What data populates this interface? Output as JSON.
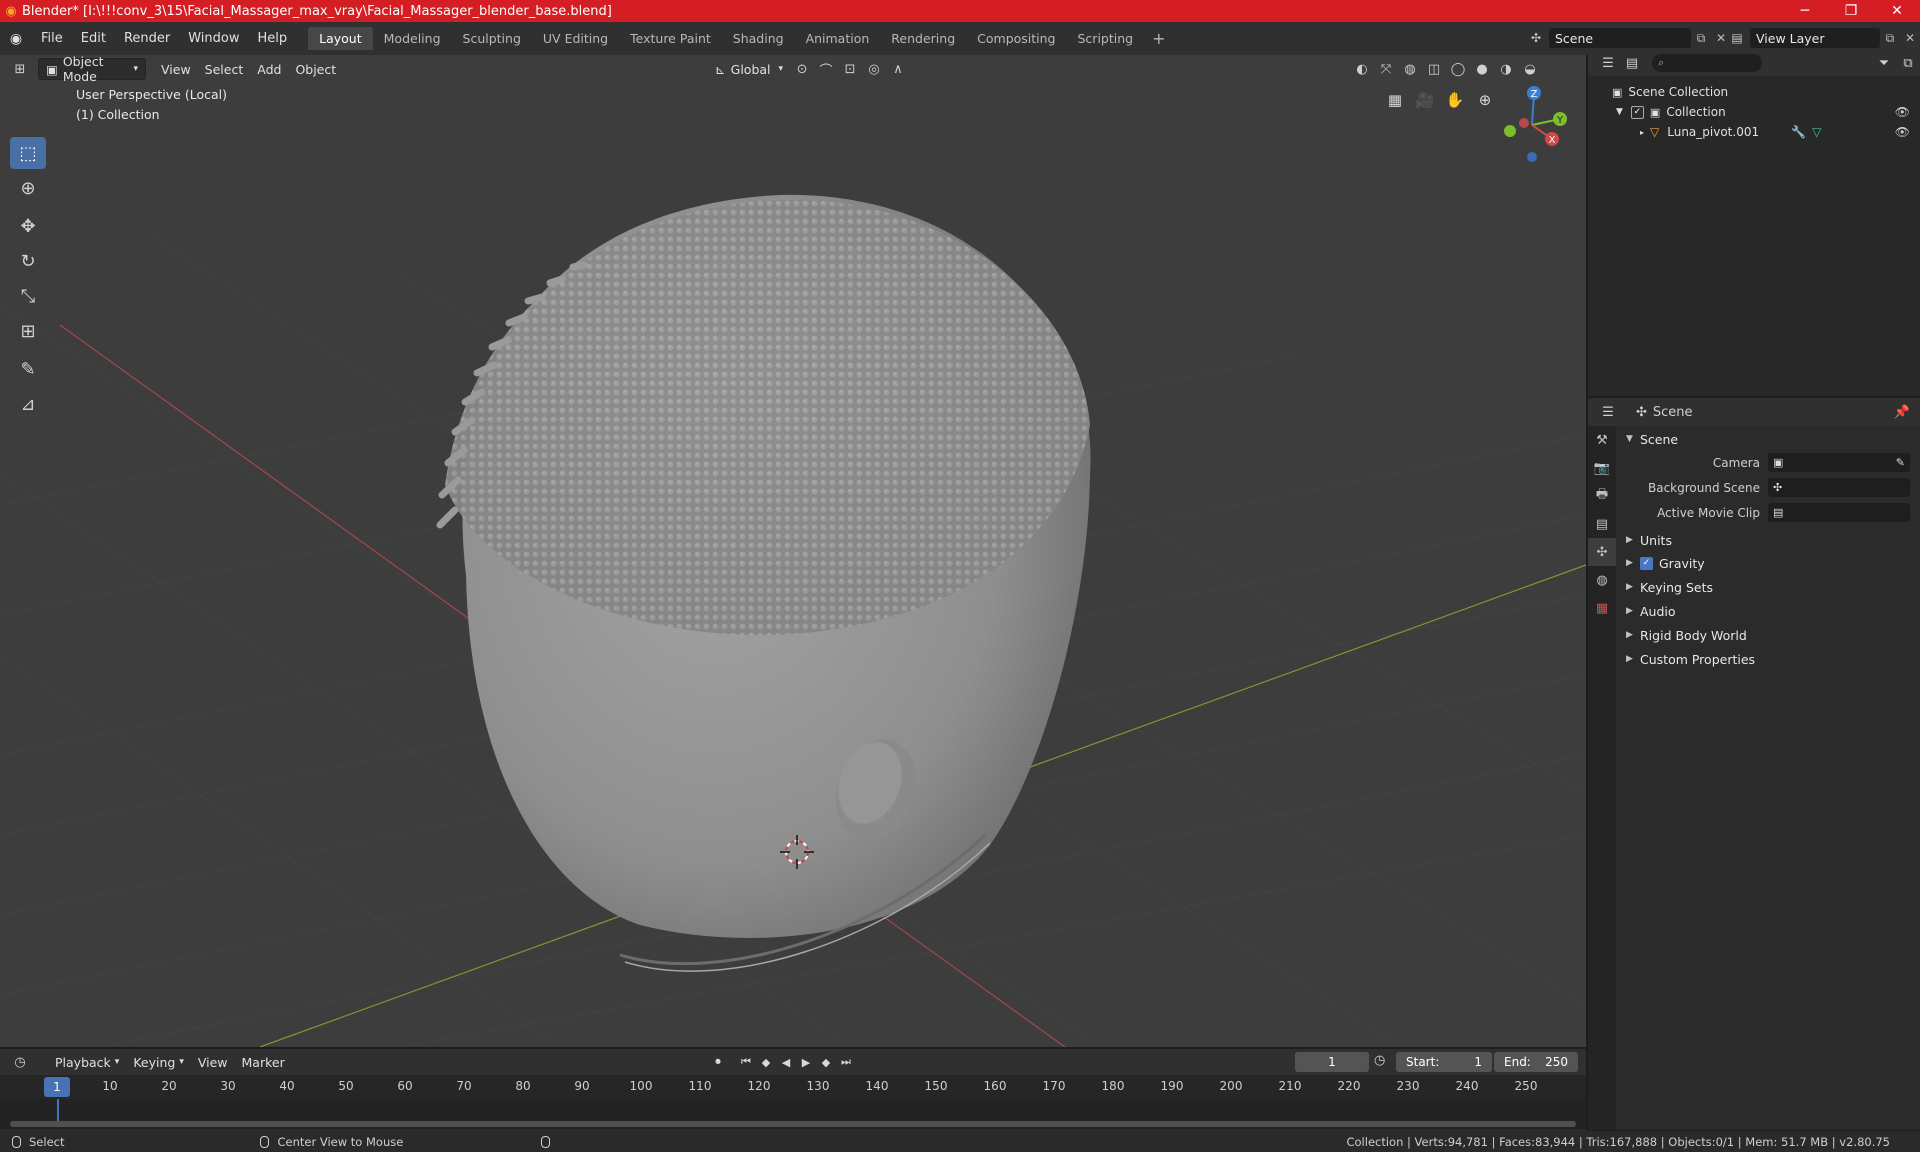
{
  "window": {
    "title": "Blender* [I:\\!!!conv_3\\15\\Facial_Massager_max_vray\\Facial_Massager_blender_base.blend]",
    "minimize": "─",
    "maximize": "❐",
    "close": "✕"
  },
  "menu": {
    "items": [
      "File",
      "Edit",
      "Render",
      "Window",
      "Help"
    ]
  },
  "workspaces": {
    "tabs": [
      "Layout",
      "Modeling",
      "Sculpting",
      "UV Editing",
      "Texture Paint",
      "Shading",
      "Animation",
      "Rendering",
      "Compositing",
      "Scripting"
    ],
    "active": "Layout",
    "add": "+"
  },
  "scene_selector": {
    "value": "Scene"
  },
  "viewlayer_selector": {
    "value": "View Layer"
  },
  "viewport": {
    "mode": "Object Mode",
    "menus": [
      "View",
      "Select",
      "Add",
      "Object"
    ],
    "transform_orientation": "Global",
    "perspective_label": "User Perspective (Local)",
    "collection_label": "(1) Collection",
    "gizmo": {
      "z": "Z",
      "y": "Y",
      "x": "X"
    }
  },
  "outliner": {
    "search_placeholder": "",
    "scene_collection": "Scene Collection",
    "collection": "Collection",
    "object": "Luna_pivot.001"
  },
  "properties": {
    "context": "Scene",
    "panel_scene": "Scene",
    "camera_label": "Camera",
    "background_scene_label": "Background Scene",
    "active_movie_clip_label": "Active Movie Clip",
    "panels": [
      "Units",
      "Gravity",
      "Keying Sets",
      "Audio",
      "Rigid Body World",
      "Custom Properties"
    ]
  },
  "timeline": {
    "menus": [
      "Playback",
      "Keying",
      "View",
      "Marker"
    ],
    "current_frame": "1",
    "start_label": "Start:",
    "start_value": "1",
    "end_label": "End:",
    "end_value": "250",
    "ruler": [
      "1",
      "10",
      "20",
      "30",
      "40",
      "50",
      "60",
      "70",
      "80",
      "90",
      "100",
      "110",
      "120",
      "130",
      "140",
      "150",
      "160",
      "170",
      "180",
      "190",
      "200",
      "210",
      "220",
      "230",
      "240",
      "250"
    ]
  },
  "status": {
    "select": "Select",
    "center_view": "Center View to Mouse",
    "stats": "Collection | Verts:94,781 | Faces:83,944 | Tris:167,888 | Objects:0/1 | Mem: 51.7 MB | v2.80.75"
  },
  "colors": {
    "titlebar": "#d51e23",
    "accent": "#4772b3",
    "viewport_bg": "#3d3d3d"
  }
}
